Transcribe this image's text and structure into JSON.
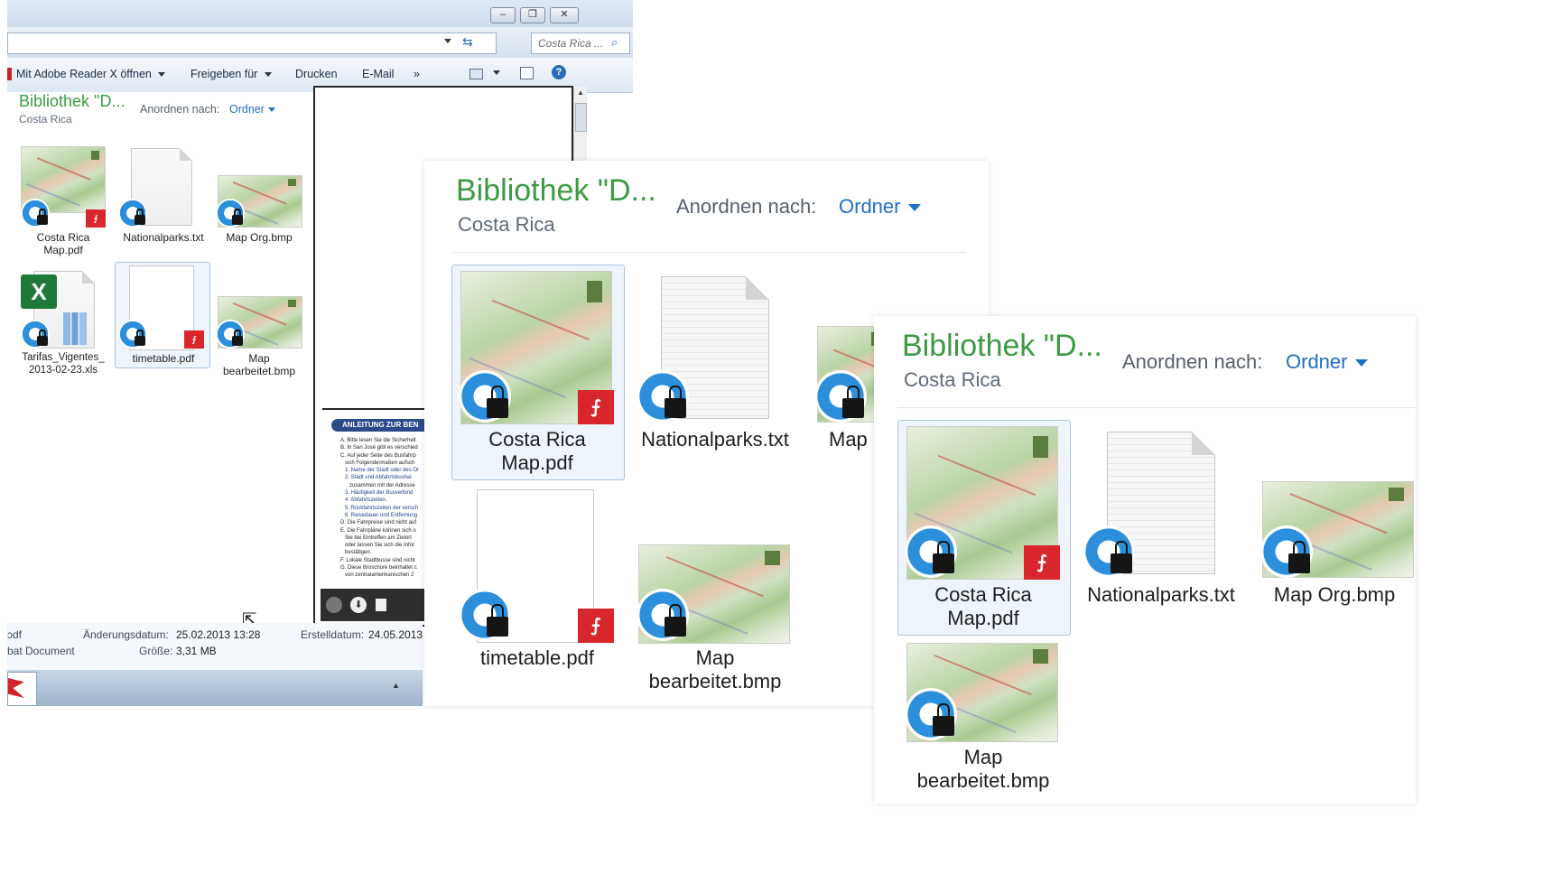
{
  "window": {
    "controls": {
      "minimize": "–",
      "restore": "❐",
      "close": "✕"
    },
    "search_placeholder": "Costa Rica ...",
    "toolbar": {
      "open_with": "Mit Adobe Reader X öffnen",
      "share": "Freigeben für",
      "print": "Drucken",
      "email": "E-Mail",
      "more": "»"
    }
  },
  "library": {
    "title": "Bibliothek \"D...",
    "subtitle": "Costa Rica",
    "arrange_label": "Anordnen nach:",
    "arrange_value": "Ordner"
  },
  "files": {
    "costa_rica_map_pdf": {
      "line1": "Costa Rica",
      "line2": "Map.pdf"
    },
    "nationalparks": {
      "name": "Nationalparks.txt"
    },
    "map_org": {
      "name": "Map Org.bmp",
      "partial": "Map"
    },
    "tarifas": {
      "line1": "Tarifas_Vigentes_",
      "line2": "2013-02-23.xls"
    },
    "timetable": {
      "name": "timetable.pdf"
    },
    "map_bearbeitet": {
      "line1": "Map",
      "line2": "bearbeitet.bmp"
    }
  },
  "preview": {
    "banner": "ANLEITUNG ZUR BEN",
    "lines": [
      "A. Bitte lesen Sie die Sicherheit",
      "B. In San José gibt es verschied",
      "C. Auf jeder Seite des Busfahrp",
      "   sich Folgendermaßen aufsch",
      "   1. Name der Stadt oder des Or",
      "   2. Stadt und Abfahrtsbushal",
      "      zusammen mit der Adresse",
      "   3. Häufigkeit der Busverbind",
      "   4. Abfahrtszeiten.",
      "   5. Rückfahrtszeiten der versch",
      "   6. Reisedauer und Entfernung",
      "D. Die Fahrpreise sind nicht auf",
      "E. Die Fahrpläne können sich o",
      "   Sie bei Eintreffen am Zielort",
      "   oder lassen Sie sich die Infor",
      "   bestätigen.",
      "F. Lokale Stadtbusse sind nicht",
      "G. Diese Broschüre beinhaltet c",
      "   von zentralamerikanischen 2"
    ]
  },
  "status": {
    "type_partial": "ɔdf",
    "type_label_partial": "bat Document",
    "modified_label": "Änderungsdatum:",
    "modified_value": "25.02.2013 13:28",
    "created_label": "Erstelldatum:",
    "created_value": "24.05.2013",
    "size_label": "Größe:",
    "size_value": "3,31 MB"
  },
  "colors": {
    "library_title": "#3c9a43",
    "link_blue": "#1f6fc5",
    "overlay_blue": "#2b8fdc",
    "pdf_red": "#d9262c"
  }
}
